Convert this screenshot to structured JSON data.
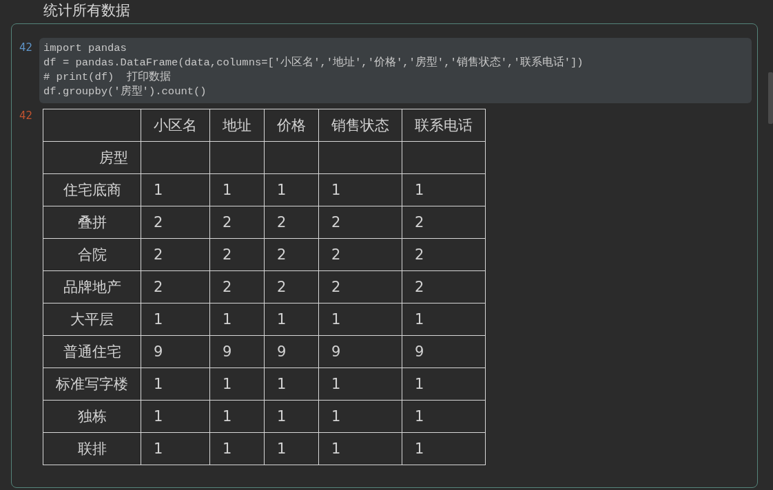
{
  "heading": "统计所有数据",
  "cell": {
    "input_prompt": "42",
    "code_lines": [
      "import pandas",
      "df = pandas.DataFrame(data,columns=['小区名','地址','价格','房型','销售状态','联系电话'])",
      "# print(df)  打印数据",
      "df.groupby('房型').count()"
    ],
    "output_prompt": "42",
    "table": {
      "columns": [
        "小区名",
        "地址",
        "价格",
        "销售状态",
        "联系电话"
      ],
      "index_name": "房型",
      "rows": [
        {
          "label": "住宅底商",
          "values": [
            "1",
            "1",
            "1",
            "1",
            "1"
          ]
        },
        {
          "label": "叠拼",
          "values": [
            "2",
            "2",
            "2",
            "2",
            "2"
          ]
        },
        {
          "label": "合院",
          "values": [
            "2",
            "2",
            "2",
            "2",
            "2"
          ]
        },
        {
          "label": "品牌地产",
          "values": [
            "2",
            "2",
            "2",
            "2",
            "2"
          ]
        },
        {
          "label": "大平层",
          "values": [
            "1",
            "1",
            "1",
            "1",
            "1"
          ]
        },
        {
          "label": "普通住宅",
          "values": [
            "9",
            "9",
            "9",
            "9",
            "9"
          ]
        },
        {
          "label": "标准写字楼",
          "values": [
            "1",
            "1",
            "1",
            "1",
            "1"
          ]
        },
        {
          "label": "独栋",
          "values": [
            "1",
            "1",
            "1",
            "1",
            "1"
          ]
        },
        {
          "label": "联排",
          "values": [
            "1",
            "1",
            "1",
            "1",
            "1"
          ]
        }
      ]
    }
  }
}
